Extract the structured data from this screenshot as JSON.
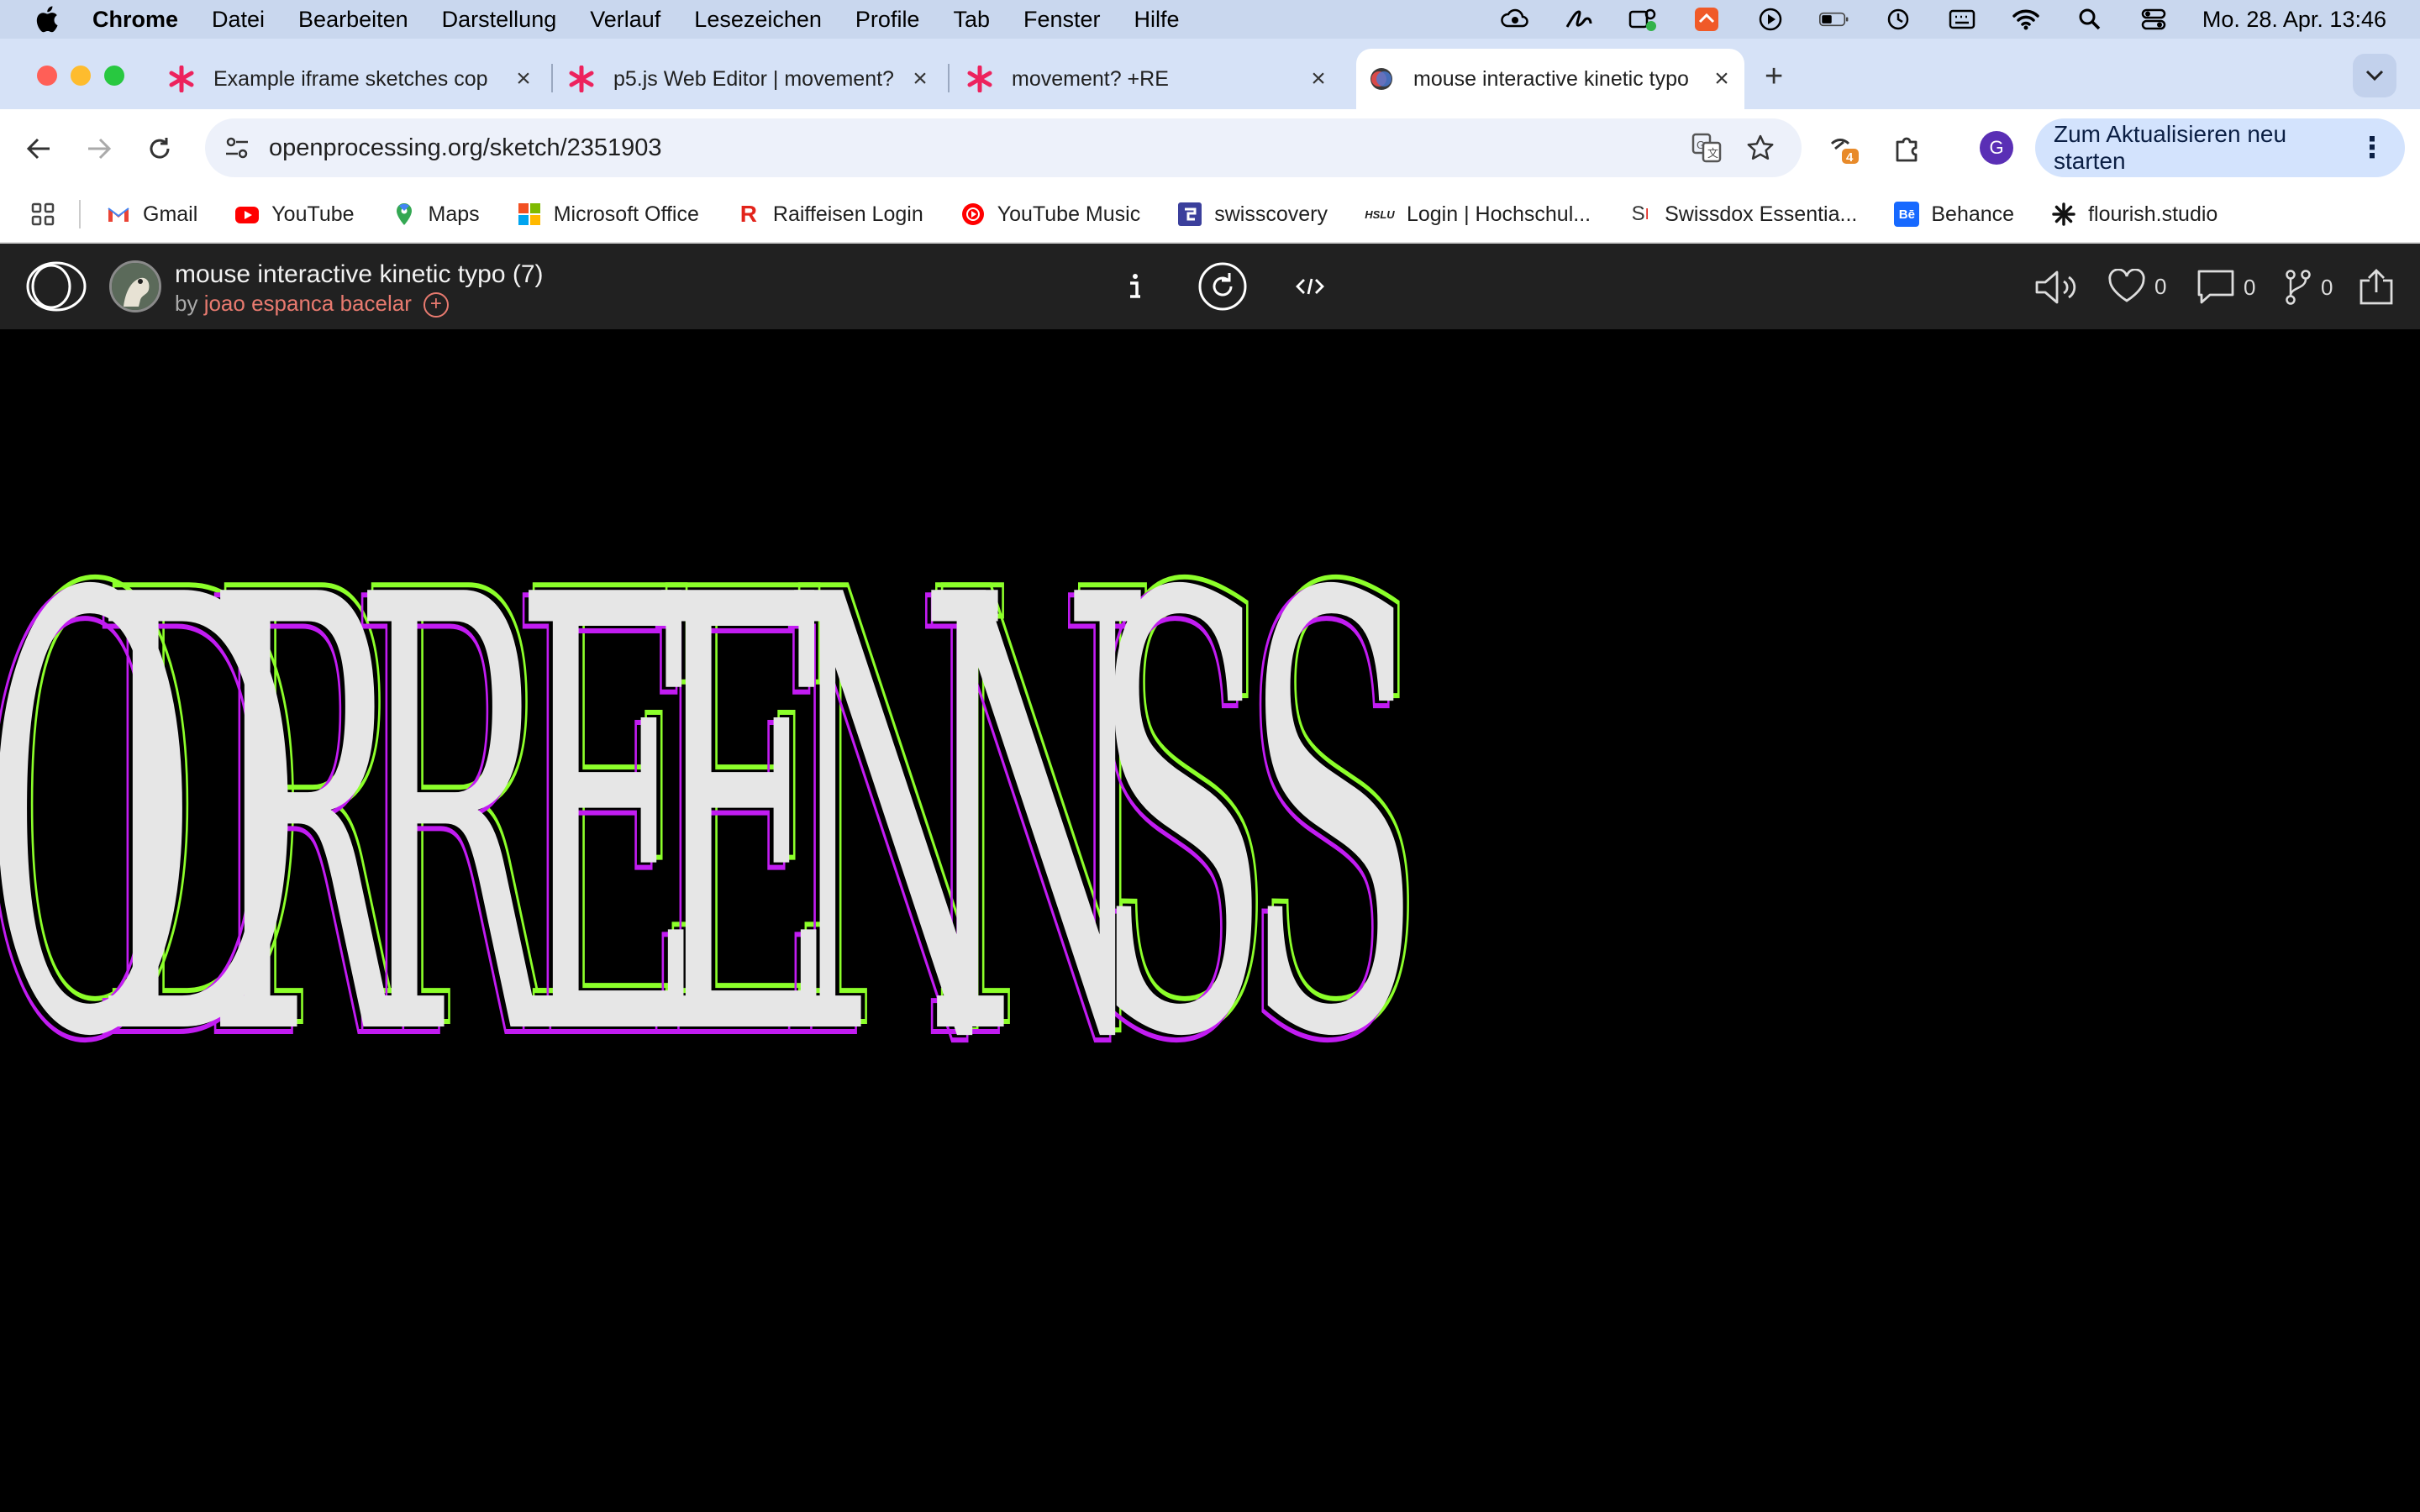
{
  "menubar": {
    "app": "Chrome",
    "items": [
      "Datei",
      "Bearbeiten",
      "Darstellung",
      "Verlauf",
      "Lesezeichen",
      "Profile",
      "Tab",
      "Fenster",
      "Hilfe"
    ],
    "clock": "Mo. 28. Apr.  13:46"
  },
  "tabs": [
    {
      "title": "Example iframe sketches cop",
      "favicon": "asterisk-icon"
    },
    {
      "title": "p5.js Web Editor | movement?",
      "favicon": "asterisk-icon"
    },
    {
      "title": "movement? +RE",
      "favicon": "asterisk-icon"
    },
    {
      "title": "mouse interactive kinetic typo",
      "favicon": "openprocessing-icon",
      "active": true
    }
  ],
  "toolbar": {
    "url_domain": "openprocessing.org",
    "url_path": "/sketch/2351903",
    "update_label": "Zum Aktualisieren neu starten",
    "profile_initial": "G",
    "extensions_badge": "4"
  },
  "bookmarks": [
    "Gmail",
    "YouTube",
    "Maps",
    "Microsoft Office",
    "Raiffeisen Login",
    "YouTube Music",
    "swisscovery",
    "Login | Hochschul...",
    "Swissdox Essentia...",
    "Behance",
    "flourish.studio"
  ],
  "sketch": {
    "title": "mouse interactive kinetic typo (7)",
    "by_prefix": "by ",
    "author": "joao espanca bacelar",
    "follow_symbol": "+",
    "likes": "0",
    "comments": "0",
    "forks": "0"
  },
  "canvas": {
    "text": "ODRREENNSS",
    "colors": {
      "fill": "#e6e6e6",
      "outline_a": "#8cff2a",
      "outline_b": "#c21cf2",
      "background": "#000000"
    }
  }
}
